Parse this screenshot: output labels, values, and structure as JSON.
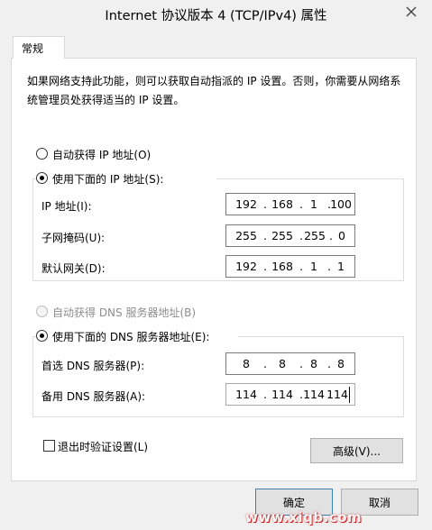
{
  "window": {
    "title": "Internet 协议版本 4 (TCP/IPv4) 属性",
    "close_icon": "close-icon"
  },
  "tabs": [
    {
      "label": "常规",
      "selected": true
    }
  ],
  "description": "如果网络支持此功能，则可以获取自动指派的 IP 设置。否则，你需要从网络系统管理员处获得适当的 IP 设置。",
  "ip": {
    "auto_label": "自动获得 IP 地址(O)",
    "manual_label": "使用下面的 IP 地址(S):",
    "selected": "manual",
    "fields": [
      {
        "label": "IP 地址(I):",
        "octets": [
          "192",
          "168",
          "1",
          "100"
        ]
      },
      {
        "label": "子网掩码(U):",
        "octets": [
          "255",
          "255",
          "255",
          "0"
        ]
      },
      {
        "label": "默认网关(D):",
        "octets": [
          "192",
          "168",
          "1",
          "1"
        ]
      }
    ]
  },
  "dns": {
    "auto_label": "自动获得 DNS 服务器地址(B)",
    "auto_disabled": true,
    "manual_label": "使用下面的 DNS 服务器地址(E):",
    "selected": "manual",
    "fields": [
      {
        "label": "首选 DNS 服务器(P):",
        "octets": [
          "8",
          "8",
          "8",
          "8"
        ]
      },
      {
        "label": "备用 DNS 服务器(A):",
        "octets": [
          "114",
          "114",
          "114",
          "114"
        ]
      }
    ]
  },
  "validate_on_exit": {
    "label": "退出时验证设置(L)",
    "checked": false
  },
  "buttons": {
    "advanced": "高级(V)...",
    "ok": "确定",
    "cancel": "取消"
  },
  "watermark": "www.xiqb.com",
  "colors": {
    "focus_border": "#3c7fb1",
    "disabled_text": "#8e8e8e",
    "watermark": "#cc0000"
  }
}
